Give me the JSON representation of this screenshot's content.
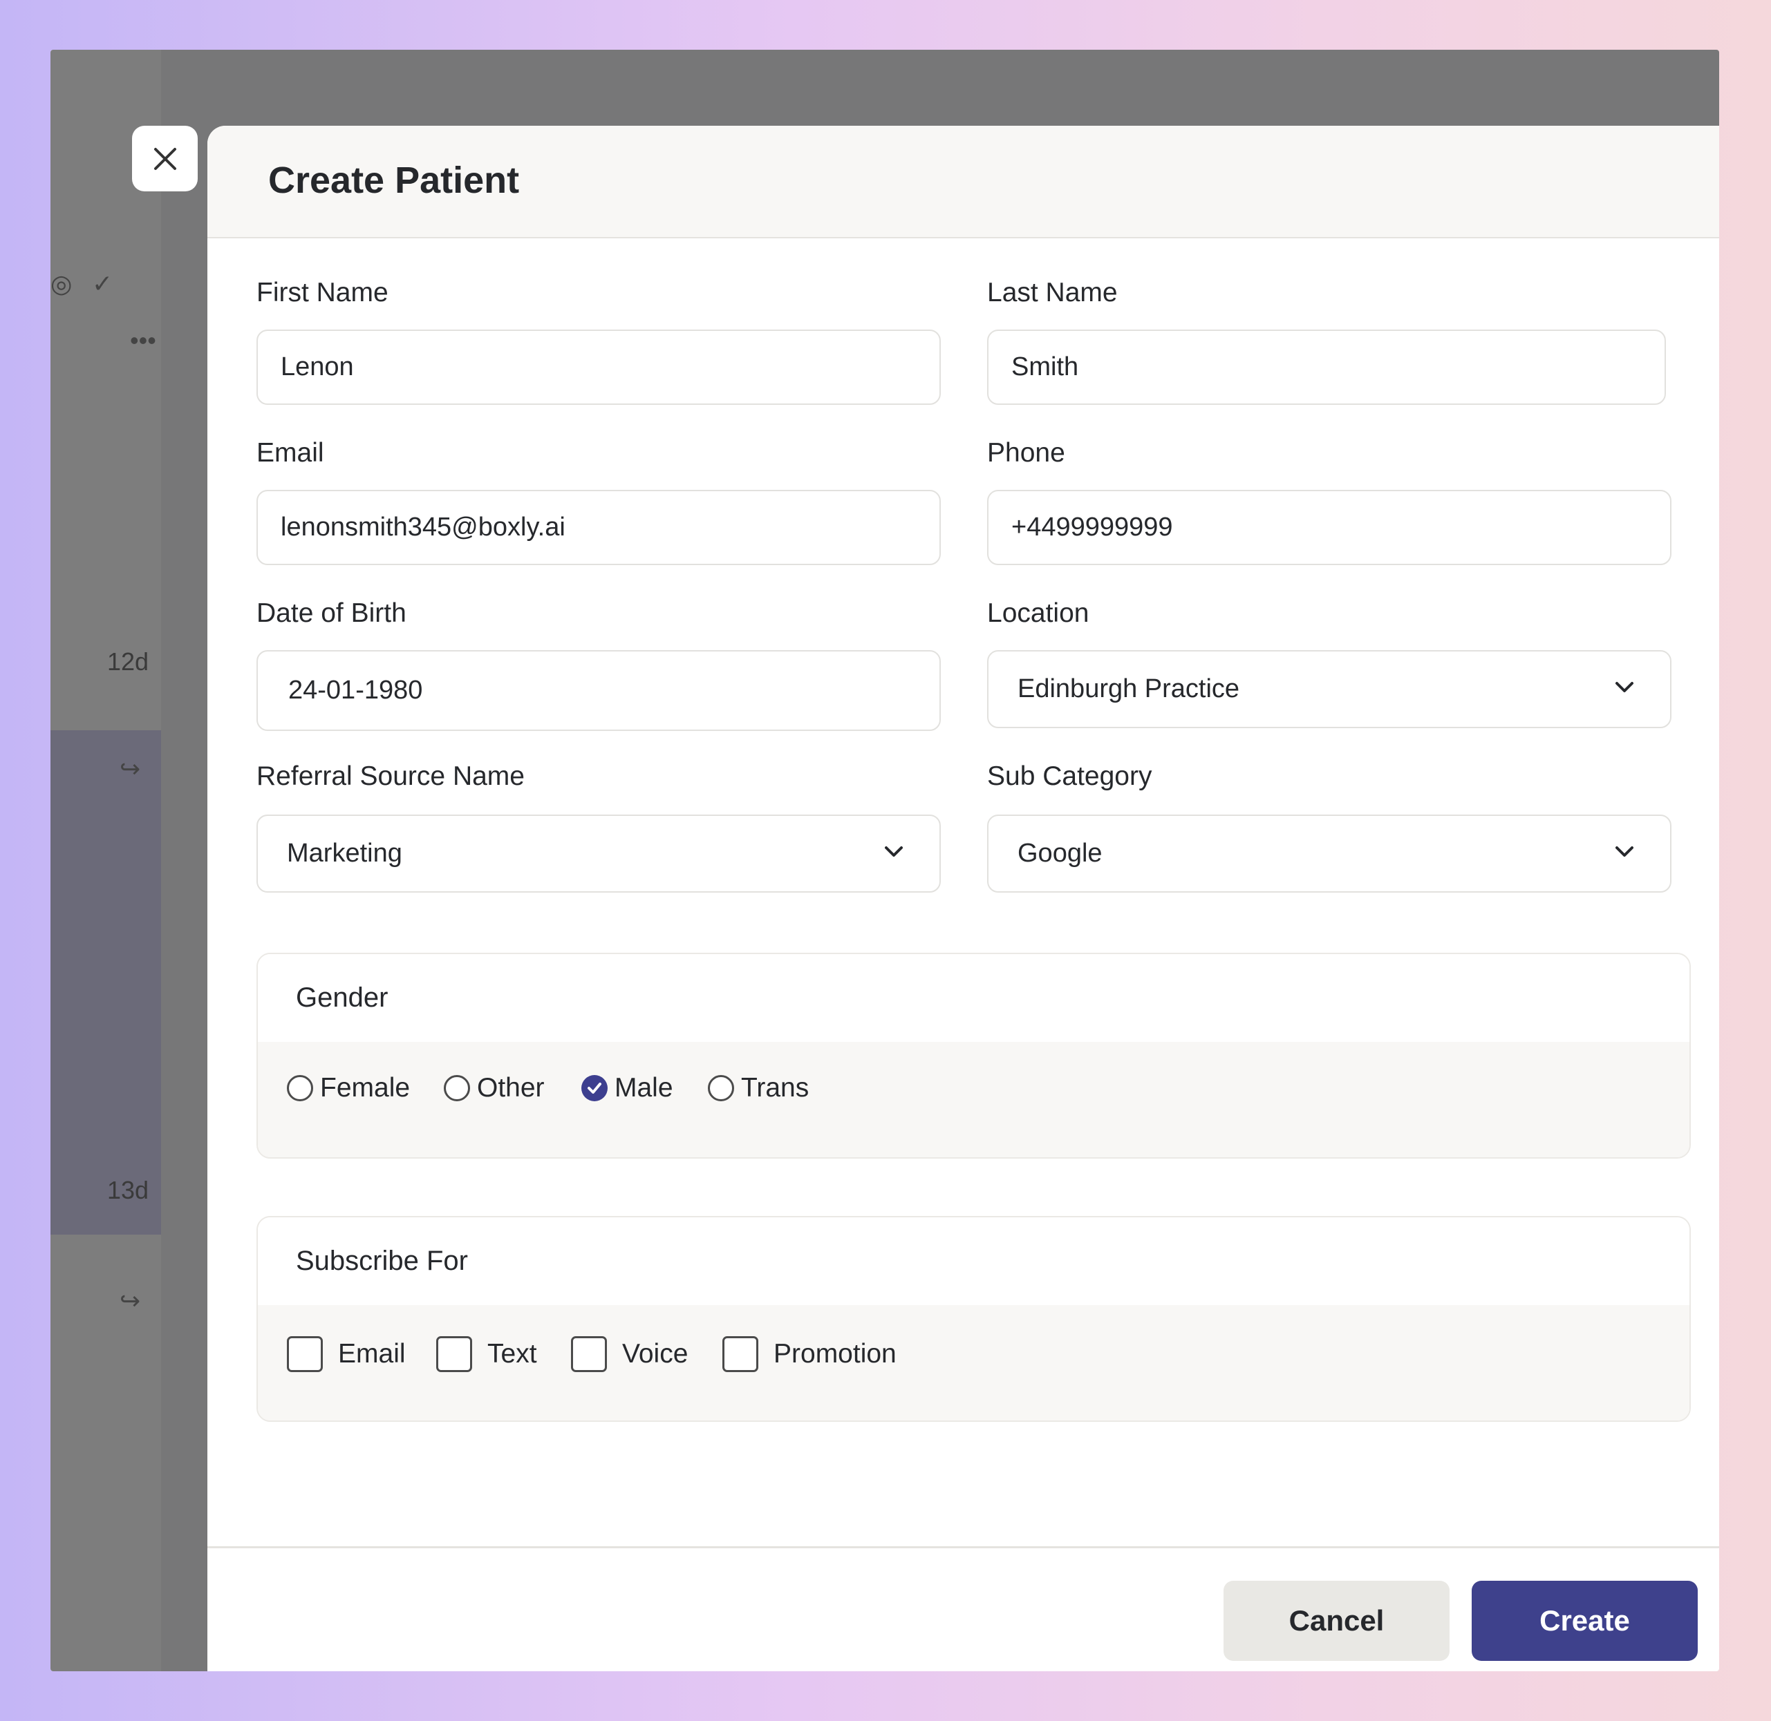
{
  "background": {
    "time_labels": [
      "12d",
      "13d"
    ]
  },
  "modal": {
    "title": "Create Patient",
    "fields": {
      "first_name": {
        "label": "First Name",
        "value": "Lenon"
      },
      "last_name": {
        "label": "Last Name",
        "value": "Smith"
      },
      "email": {
        "label": "Email",
        "value": "lenonsmith345@boxly.ai"
      },
      "phone": {
        "label": "Phone",
        "value": "+4499999999"
      },
      "dob": {
        "label": "Date of Birth",
        "value": "24-01-1980"
      },
      "location": {
        "label": "Location",
        "value": "Edinburgh Practice"
      },
      "referral_source": {
        "label": "Referral Source Name",
        "value": "Marketing"
      },
      "sub_category": {
        "label": "Sub Category",
        "value": "Google"
      }
    },
    "gender": {
      "title": "Gender",
      "options": [
        "Female",
        "Other",
        "Male",
        "Trans"
      ],
      "selected": "Male"
    },
    "subscribe": {
      "title": "Subscribe For",
      "options": [
        "Email",
        "Text",
        "Voice",
        "Promotion"
      ],
      "checked": []
    },
    "buttons": {
      "cancel": "Cancel",
      "create": "Create"
    }
  },
  "colors": {
    "primary": "#3e418c",
    "chat_fab": "#503aa3",
    "radio_selected": "#3d3f8f"
  },
  "icons": {
    "close": "close-icon",
    "chevron": "chevron-down-icon",
    "chat": "chat-bubble-icon",
    "reply": "reply-arrow-icon"
  }
}
